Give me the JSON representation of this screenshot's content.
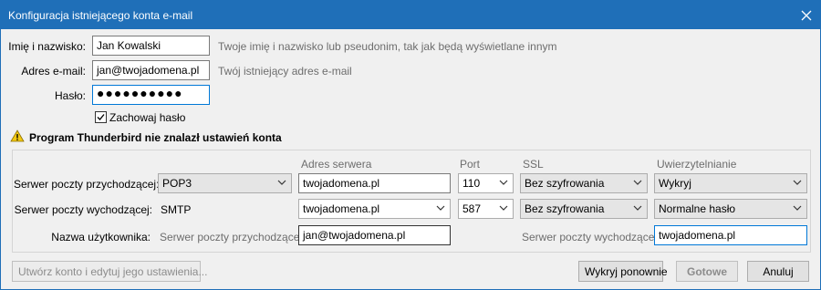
{
  "window": {
    "title": "Konfiguracja istniejącego konta e-mail"
  },
  "identity": {
    "name_label": "Imię i nazwisko:",
    "name_value": "Jan Kowalski",
    "name_hint": "Twoje imię i nazwisko lub pseudonim, tak jak będą wyświetlane innym",
    "email_label": "Adres e-mail:",
    "email_value": "jan@twojadomena.pl",
    "email_hint": "Twój istniejący adres e-mail",
    "password_label": "Hasło:",
    "password_value": "●●●●●●●●●●",
    "remember_label": "Zachowaj hasło",
    "remember_checked": true
  },
  "warning": {
    "icon": "warning-icon",
    "text": "Program Thunderbird nie znalazł ustawień konta"
  },
  "server_table": {
    "columns": {
      "address": "Adres serwera",
      "port": "Port",
      "ssl": "SSL",
      "auth": "Uwierzytelnianie"
    },
    "incoming": {
      "label": "Serwer poczty przychodzącej:",
      "protocol": "POP3",
      "address": "twojadomena.pl",
      "port": "110",
      "ssl": "Bez szyfrowania",
      "auth": "Wykryj"
    },
    "outgoing": {
      "label": "Serwer poczty wychodzącej:",
      "protocol": "SMTP",
      "address": "twojadomena.pl",
      "port": "587",
      "ssl": "Bez szyfrowania",
      "auth": "Normalne hasło"
    },
    "username": {
      "label": "Nazwa użytkownika:",
      "incoming_label": "Serwer poczty przychodzącej:",
      "incoming_value": "jan@twojadomena.pl",
      "outgoing_label": "Serwer poczty wychodzącej:",
      "outgoing_value": "twojadomena.pl"
    }
  },
  "buttons": {
    "advanced": "Utwórz konto i edytuj jego ustawienia...",
    "retest": "Wykryj ponownie",
    "done": "Gotowe",
    "cancel": "Anuluj"
  },
  "colors": {
    "titlebar": "#1f6fb8",
    "focus": "#0078d7",
    "warning": "#f2c811"
  }
}
